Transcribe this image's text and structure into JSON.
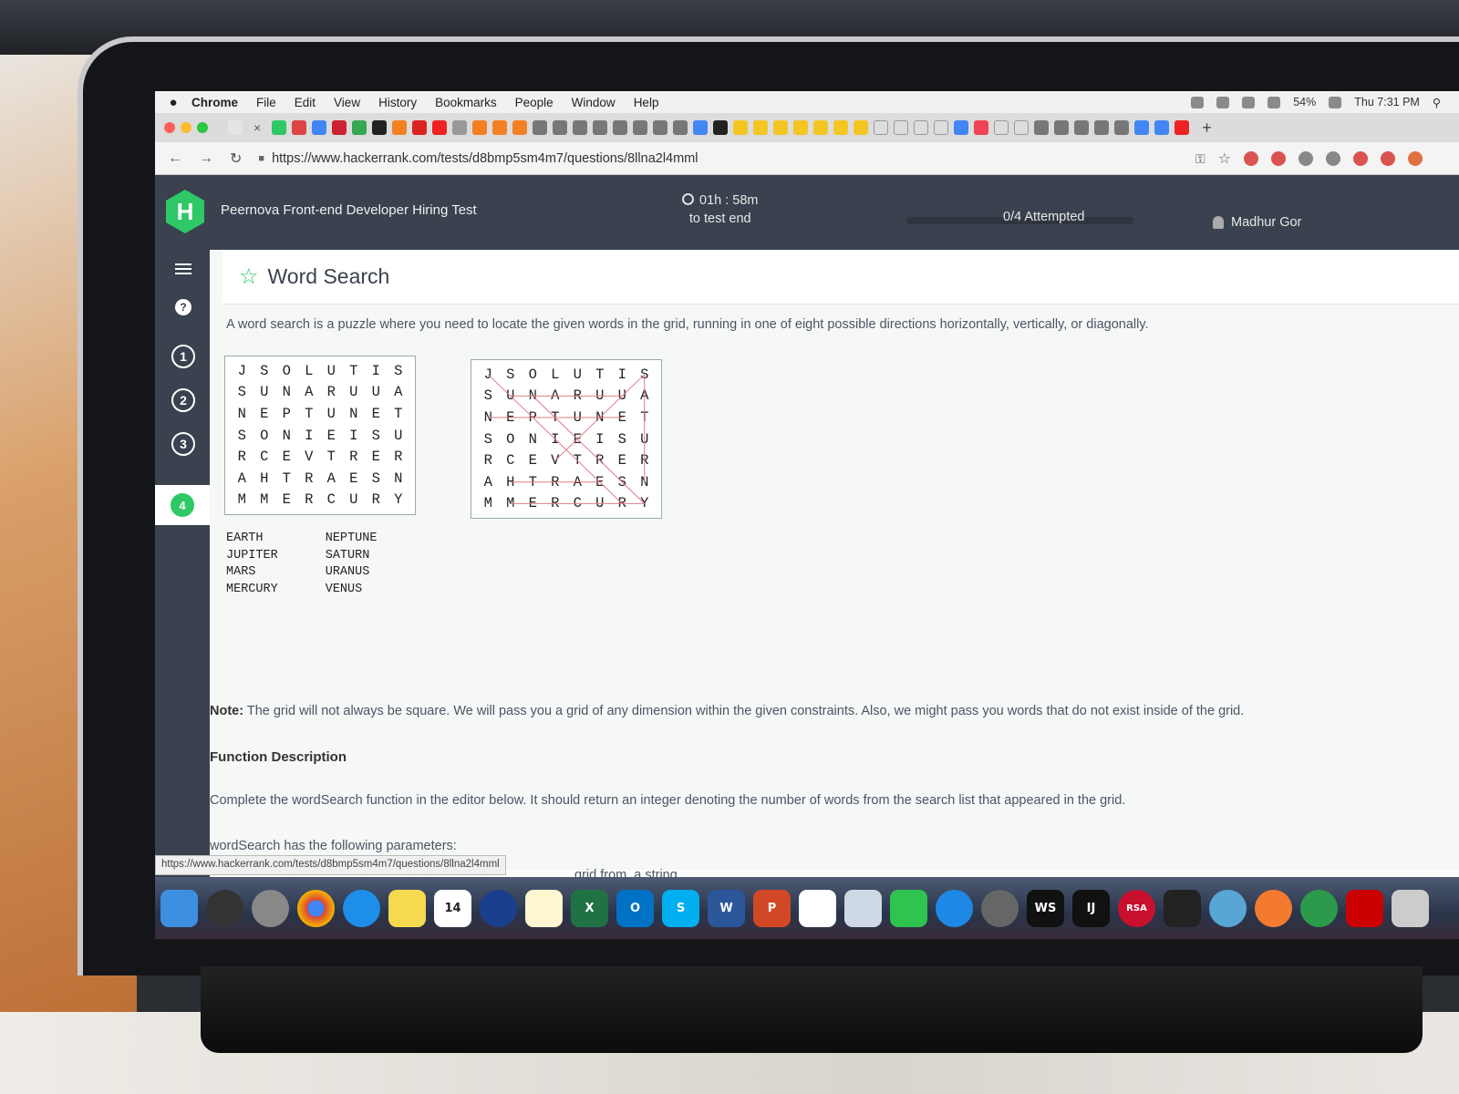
{
  "menubar": {
    "app": "Chrome",
    "items": [
      "File",
      "Edit",
      "View",
      "History",
      "Bookmarks",
      "People",
      "Window",
      "Help"
    ],
    "battery": "54%",
    "clock": "Thu 7:31 PM"
  },
  "browser": {
    "url": "https://www.hackerrank.com/tests/d8bmp5sm4m7/questions/8llna2l4mml",
    "status_url": "https://www.hackerrank.com/tests/d8bmp5sm4m7/questions/8llna2l4mml"
  },
  "header": {
    "logo_letter": "H",
    "test_title": "Peernova Front-end Developer Hiring Test",
    "timer": "01h : 58m",
    "timer_sub": "to test end",
    "attempted": "0/4 Attempted",
    "progress_fraction": 0.0,
    "user": "Madhur Gor"
  },
  "nav": {
    "questions": [
      "1",
      "2",
      "3",
      "4"
    ]
  },
  "question": {
    "title": "Word Search",
    "description": "A word search is a puzzle where you need to locate the given words in the grid, running in one of eight possible directions horizontally, vertically, or diagonally.",
    "grid": [
      [
        "J",
        "S",
        "O",
        "L",
        "U",
        "T",
        "I",
        "S"
      ],
      [
        "S",
        "U",
        "N",
        "A",
        "R",
        "U",
        "U",
        "A"
      ],
      [
        "N",
        "E",
        "P",
        "T",
        "U",
        "N",
        "E",
        "T"
      ],
      [
        "S",
        "O",
        "N",
        "I",
        "E",
        "I",
        "S",
        "U"
      ],
      [
        "R",
        "C",
        "E",
        "V",
        "T",
        "R",
        "E",
        "R"
      ],
      [
        "A",
        "H",
        "T",
        "R",
        "A",
        "E",
        "S",
        "N"
      ],
      [
        "M",
        "M",
        "E",
        "R",
        "C",
        "U",
        "R",
        "Y"
      ]
    ],
    "words_col1": [
      "EARTH",
      "JUPITER",
      "MARS",
      "MERCURY"
    ],
    "words_col2": [
      "NEPTUNE",
      "SATURN",
      "URANUS",
      "VENUS"
    ],
    "note_label": "Note:",
    "note": "The grid will not always be square. We will pass you a grid of any dimension within the given constraints. Also, we might pass you words that do not exist inside of the grid.",
    "fn_heading": "Function Description",
    "fn_desc": "Complete the wordSearch function in the editor below. It should return an integer denoting the number of words from the search list that appeared in the grid.",
    "params": "wordSearch has the following parameters:",
    "params_partial": "grid from, a string."
  },
  "colors": {
    "hr_green": "#2ec866",
    "hr_dark": "#39424e"
  }
}
